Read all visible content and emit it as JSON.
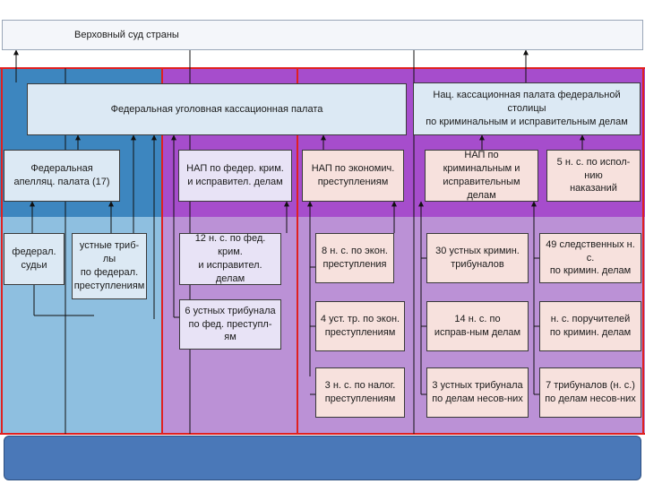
{
  "supreme_court": "Верховный суд страны",
  "federal_cassation": "Федеральная уголовная кассационная палата",
  "national_cassation": "Нац. кассационная палата федеральной столицы\nпо криминальным и исправительным делам",
  "level2": {
    "federal_appeal": "Федеральная\nапелляц. палата (17)",
    "nap_federal": "НАП по федер. крим.\nи исправител. делам",
    "nap_economic": "НАП по экономич.\nпреступлениям",
    "nap_criminal": "НАП по криминальным и\nисправительным делам",
    "execution_courts": "5 н. с. по испол-нию\nнаказаний"
  },
  "level3": {
    "federal_judges": "федерал.\nсудьи",
    "oral_tribunals_federal": "устные триб-лы\nпо федерал.\nпреступлениям",
    "courts_12": "12 н. с. по фед. крим.\nи исправител. делам",
    "courts_8_econ": "8 н. с. по экон.\nпреступления",
    "oral_30": "30 устных кримин.\nтрибуналов",
    "investigative_49": "49 следственных н. с.\nпо кримин. делам"
  },
  "level4": {
    "oral_6": "6 устных трибунала\nпо фед. преступл-ям",
    "oral_4_econ": "4 уст. тр. по экон.\nпреступлениям",
    "courts_14": "14 н. с. по\nисправ-ным делам",
    "guarantors": "н. с. поручителей\nпо кримин. делам"
  },
  "level5": {
    "tax_3": "3 н. с. по налог.\nпреступлениям",
    "oral_3_minors": "3 устных трибунала\nпо делам несов-них",
    "tribunals_7_minors": "7 трибуналов (н. с.)\nпо делам несов-них"
  },
  "colors": {
    "blue_dark": "#3d86bf",
    "blue_light": "#8ebfe0",
    "purple_dark": "#a64dcc",
    "purple_light": "#bb91d6",
    "separator": "#e02020",
    "footer": "#4a78b8"
  }
}
